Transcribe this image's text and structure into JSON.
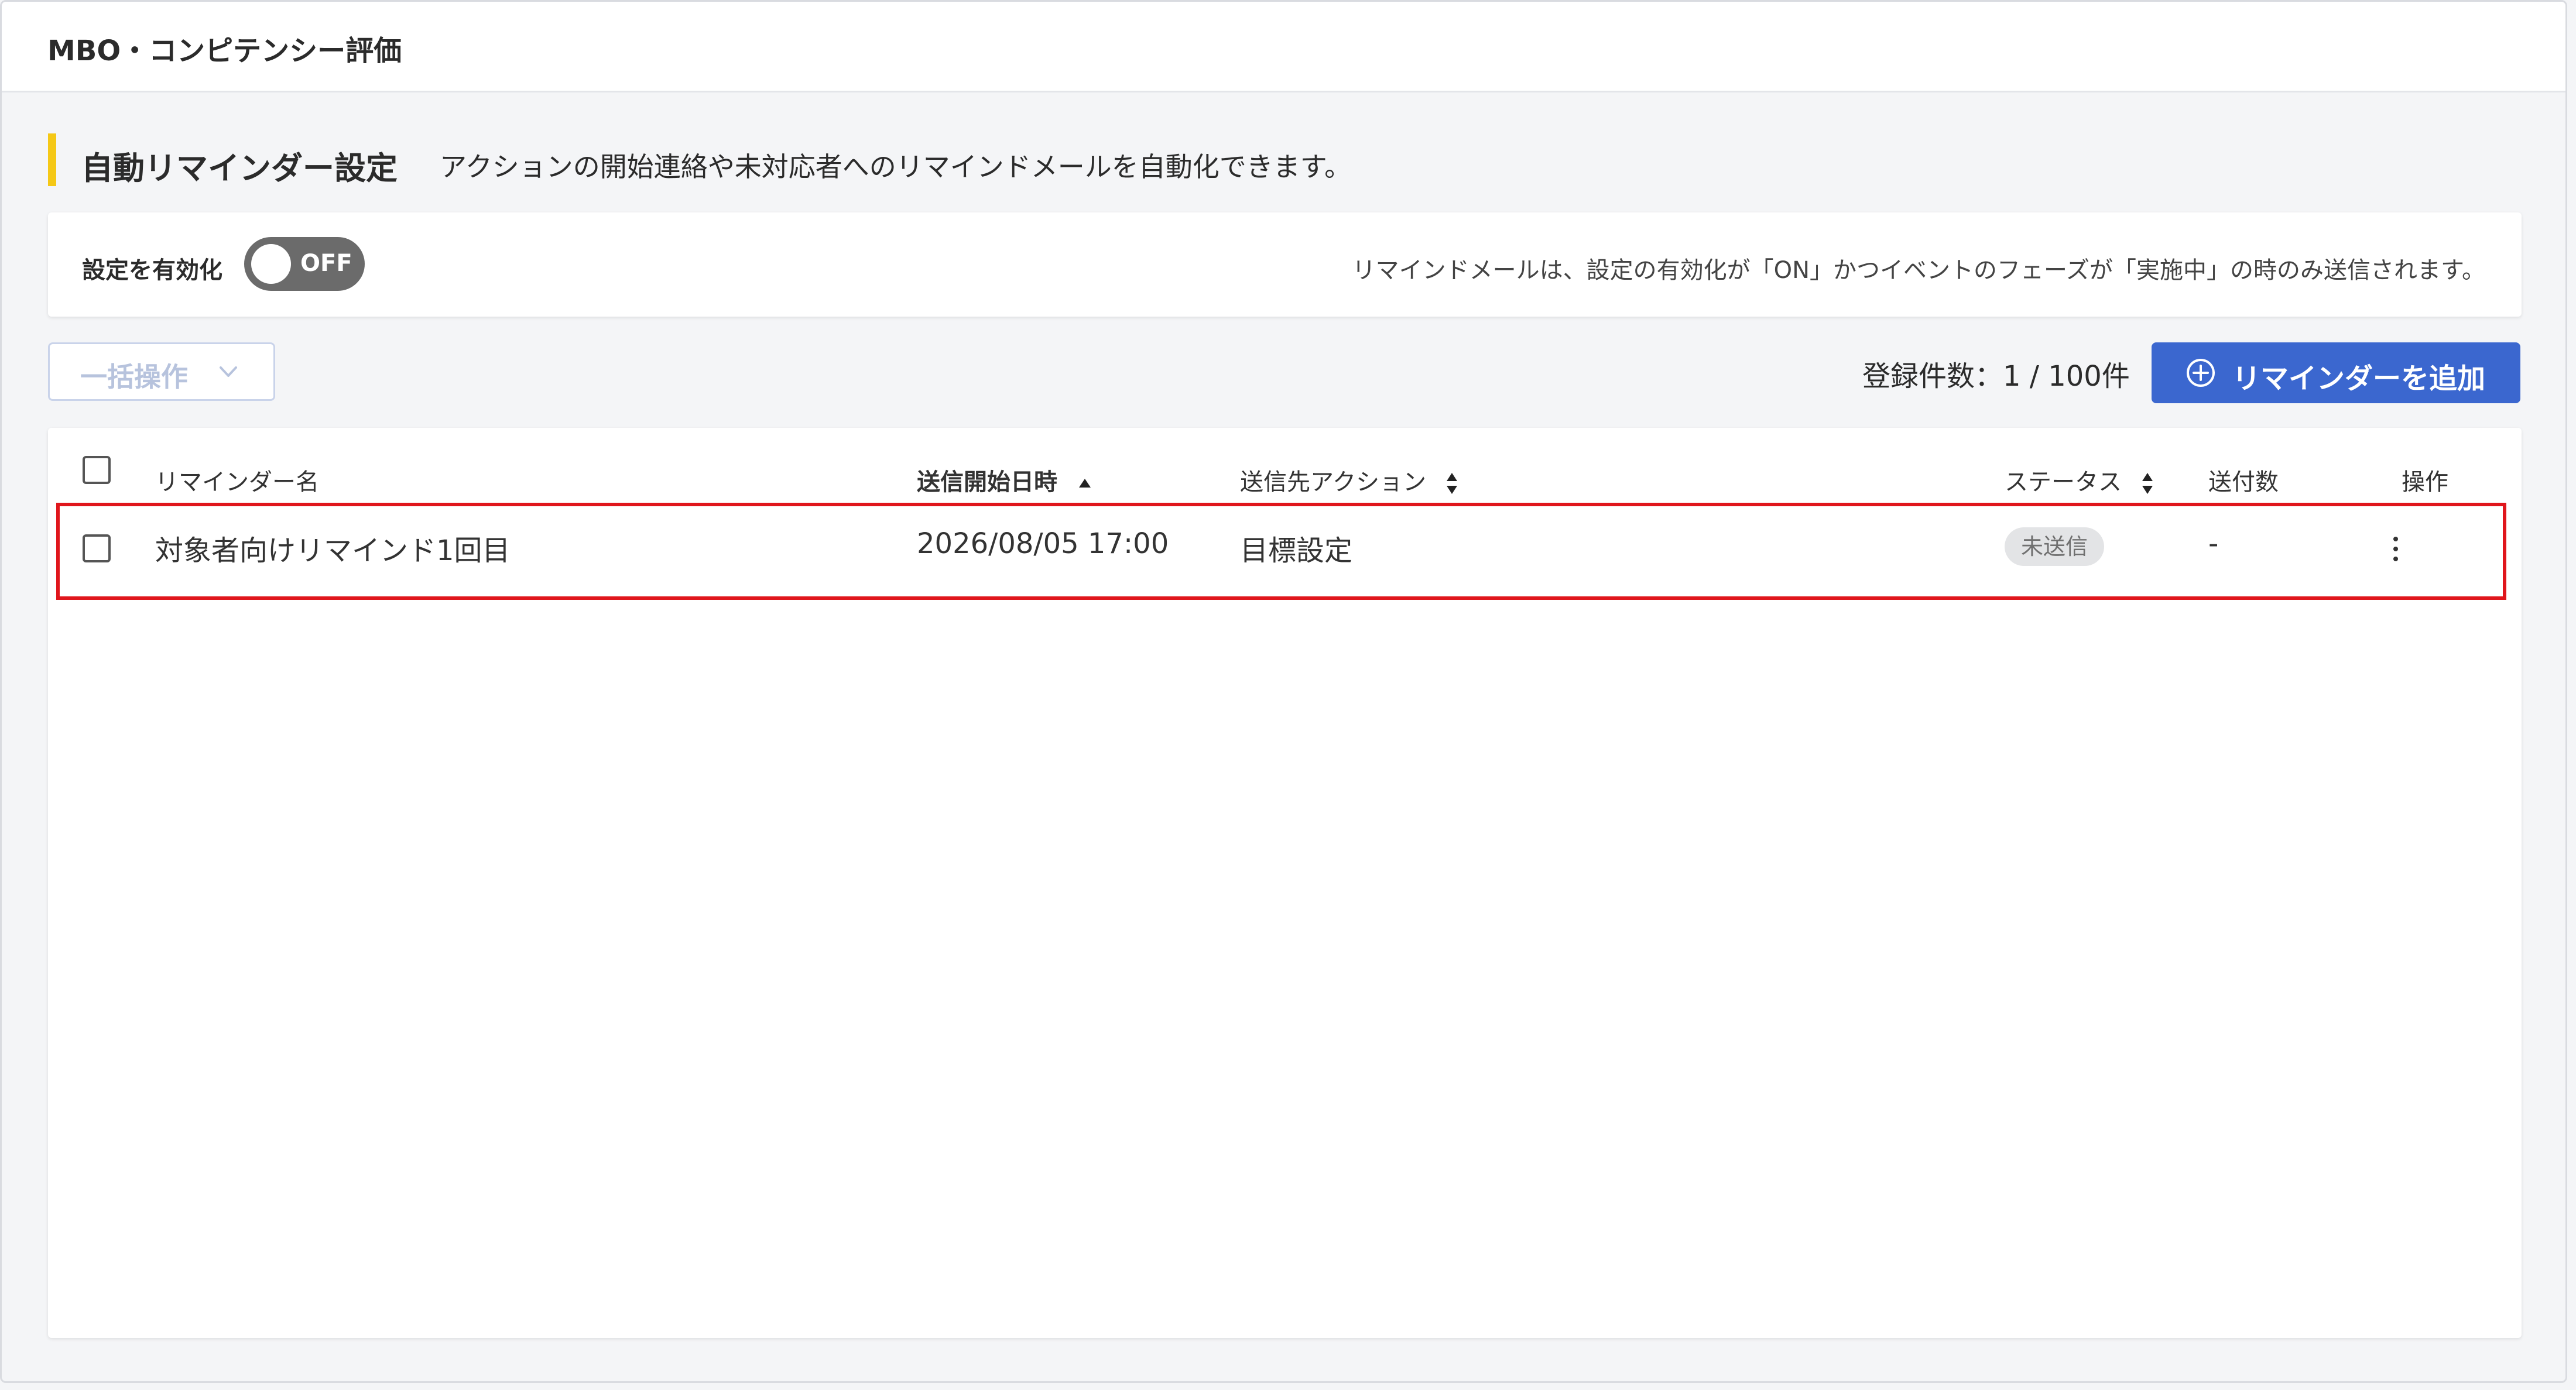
{
  "app": {
    "title": "MBO・コンピテンシー評価"
  },
  "section": {
    "title": "自動リマインダー設定",
    "description": "アクションの開始連絡や未対応者へのリマインドメールを自動化できます。"
  },
  "settings": {
    "enable_label": "設定を有効化",
    "toggle_state": "OFF",
    "note": "リマインドメールは、設定の有効化が「ON」かつイベントのフェーズが「実施中」の時のみ送信されます。"
  },
  "toolbar": {
    "bulk_label": "一括操作",
    "count_text": "登録件数：1 / 100件",
    "add_label": "リマインダーを追加"
  },
  "table": {
    "headers": {
      "name": "リマインダー名",
      "start": "送信開始日時",
      "action": "送信先アクション",
      "status": "ステータス",
      "sent": "送付数",
      "ops": "操作"
    },
    "rows": [
      {
        "name": "対象者向けリマインド1回目",
        "start": "2026/08/05 17:00",
        "action": "目標設定",
        "status": "未送信",
        "sent": "-"
      }
    ]
  },
  "colors": {
    "accent": "#3b67cf",
    "section_marker": "#f5c816",
    "highlight": "#e0161c"
  }
}
